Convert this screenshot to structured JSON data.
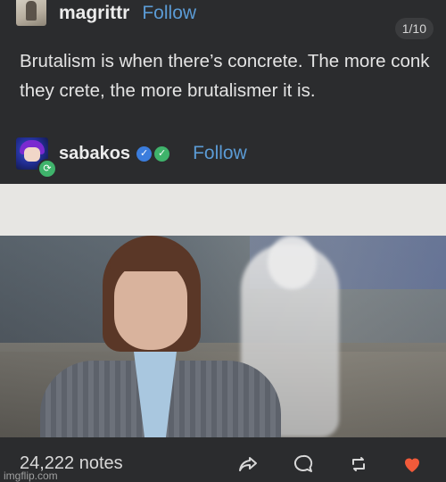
{
  "post": {
    "author": "magrittr",
    "follow_label": "Follow",
    "counter": "1/10",
    "text": "Brutalism is when there’s concrete. The more conk they crete, the more brutalismer it is."
  },
  "reblog": {
    "author": "sabakos",
    "follow_label": "Follow",
    "verified_badge": "check-badge",
    "green_badge": "check-badge",
    "reblog_icon": "reblog-icon"
  },
  "footer": {
    "notes": "24,222 notes",
    "watermark": "imgflip.com",
    "icons": [
      "share-icon",
      "comment-icon",
      "reblog-icon",
      "like-heart-icon"
    ]
  },
  "colors": {
    "background": "#2b2c2e",
    "follow_blue": "#5b9bd5",
    "heart": "#f15a3a",
    "bubble": "#e7e6e3"
  }
}
